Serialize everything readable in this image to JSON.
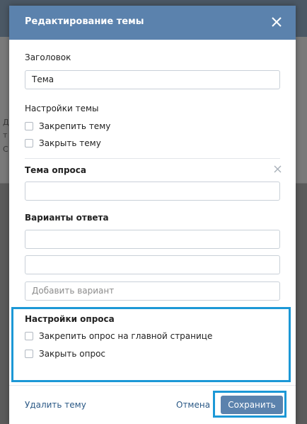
{
  "background": {
    "fragments": [
      "Д",
      "т",
      "С"
    ]
  },
  "modal": {
    "title": "Редактирование темы",
    "close_icon": "close-icon",
    "title_label": "Заголовок",
    "title_value": "Тема",
    "topic_settings": {
      "heading": "Настройки темы",
      "options": [
        "Закрепить тему",
        "Закрыть тему"
      ]
    },
    "poll": {
      "topic_label": "Тема опроса",
      "topic_value": "",
      "answers_label": "Варианты ответа",
      "answers": [
        "",
        ""
      ],
      "add_placeholder": "Добавить вариант"
    },
    "poll_settings": {
      "heading": "Настройки опроса",
      "options": [
        "Закрепить опрос на главной странице",
        "Закрыть опрос"
      ]
    },
    "footer": {
      "delete_label": "Удалить тему",
      "cancel_label": "Отмена",
      "save_label": "Сохранить"
    }
  },
  "colors": {
    "header": "#5b82ad",
    "highlight": "#1c98d6",
    "link": "#2a5885"
  }
}
